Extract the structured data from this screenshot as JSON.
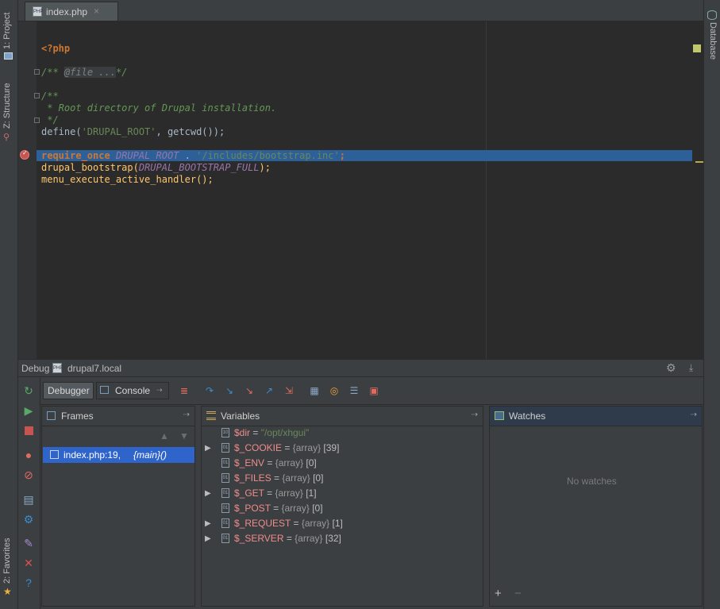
{
  "left_strip": {
    "project_tab": "1: Project",
    "structure_tab": "Z: Structure",
    "favorites_tab": "2: Favorites"
  },
  "right_strip": {
    "database_tab": "Database"
  },
  "editor_tab": {
    "label": "index.php",
    "close": "×"
  },
  "code_lines": {
    "l1": "<?php",
    "l2_open": "/**",
    "l2_fold": "@file ...",
    "l2_close": "*/",
    "l3": "/**",
    "l4": " * Root directory of Drupal installation.",
    "l5": " */",
    "l6_fn": "define(",
    "l6_str": "'DRUPAL_ROOT'",
    "l6_rest": ", getcwd());",
    "l7_kw": "require_once",
    "l7_const": "DRUPAL_ROOT",
    "l7_op": " . ",
    "l7_str": "'/includes/bootstrap.inc'",
    "l7_end": ";",
    "l8_fn": "drupal_bootstrap(",
    "l8_const": "DRUPAL_BOOTSTRAP_FULL",
    "l8_end": ");",
    "l9": "menu_execute_active_handler();"
  },
  "debug": {
    "title": "Debug",
    "session": "drupal7.local",
    "tab_debugger": "Debugger",
    "tab_console": "Console",
    "frames_title": "Frames",
    "frame_item": "index.php:19,",
    "frame_main": "{main}()",
    "variables_title": "Variables",
    "watches_title": "Watches",
    "no_watches": "No watches",
    "add_watch": "+",
    "remove_watch": "−"
  },
  "variables": [
    {
      "name": "$dir",
      "eq": " = ",
      "type": "",
      "value": "\"/opt/xhgui\"",
      "expandable": false
    },
    {
      "name": "$_COOKIE",
      "eq": " = ",
      "type": "{array}",
      "value": " [39]",
      "expandable": true
    },
    {
      "name": "$_ENV",
      "eq": " = ",
      "type": "{array}",
      "value": " [0]",
      "expandable": false
    },
    {
      "name": "$_FILES",
      "eq": " = ",
      "type": "{array}",
      "value": " [0]",
      "expandable": false
    },
    {
      "name": "$_GET",
      "eq": " = ",
      "type": "{array}",
      "value": " [1]",
      "expandable": true
    },
    {
      "name": "$_POST",
      "eq": " = ",
      "type": "{array}",
      "value": " [0]",
      "expandable": false
    },
    {
      "name": "$_REQUEST",
      "eq": " = ",
      "type": "{array}",
      "value": " [1]",
      "expandable": true
    },
    {
      "name": "$_SERVER",
      "eq": " = ",
      "type": "{array}",
      "value": " [32]",
      "expandable": true
    }
  ],
  "colors": {
    "editor_bg": "#2b2b2b",
    "exec_line": "#2d6099",
    "breakpoint": "#c75450",
    "selection": "#4b6eaf"
  }
}
